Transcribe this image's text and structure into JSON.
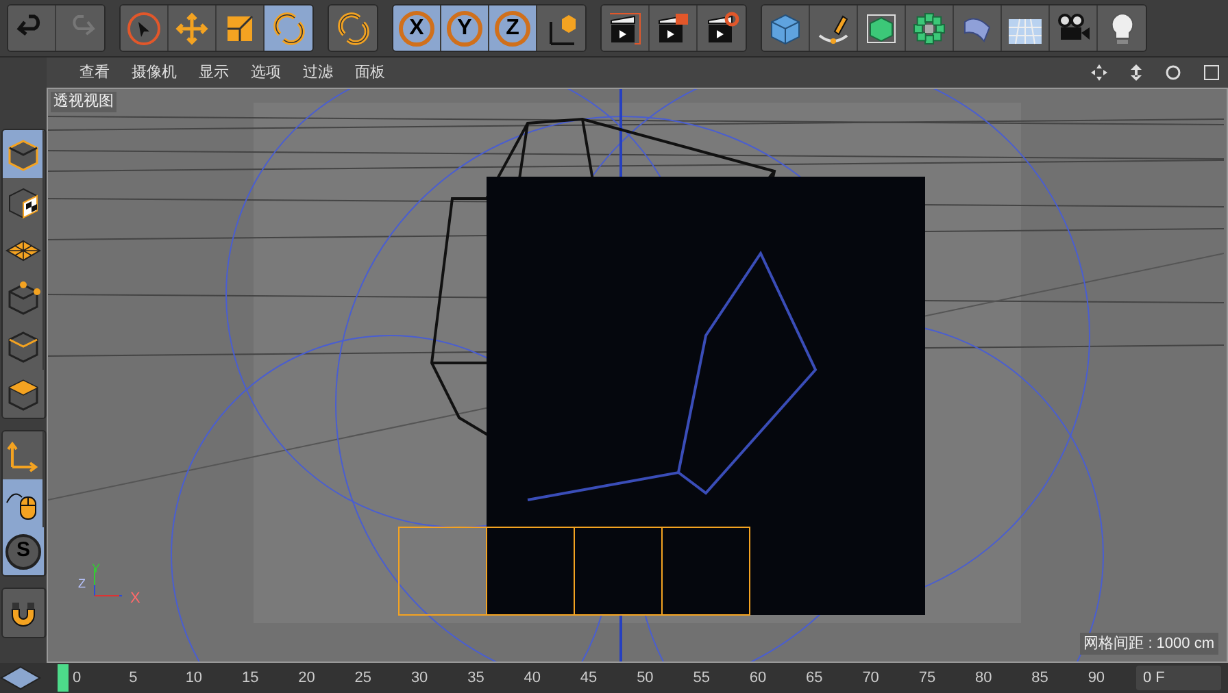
{
  "toolbar": {
    "groups": [
      {
        "buttons": [
          {
            "kind": "undo",
            "selected": false
          },
          {
            "kind": "redo",
            "selected": false
          }
        ]
      },
      {
        "buttons": [
          {
            "kind": "select",
            "selected": false
          },
          {
            "kind": "move",
            "selected": false
          },
          {
            "kind": "scale",
            "selected": false
          },
          {
            "kind": "rotate",
            "selected": true
          }
        ]
      },
      {
        "buttons": [
          {
            "kind": "rotate",
            "selected": false
          }
        ]
      },
      {
        "buttons": [
          {
            "kind": "axis",
            "label": "X",
            "selected": true
          },
          {
            "kind": "axis",
            "label": "Y",
            "selected": true
          },
          {
            "kind": "axis",
            "label": "Z",
            "selected": true
          },
          {
            "kind": "coords",
            "selected": false
          }
        ]
      },
      {
        "buttons": [
          {
            "kind": "render",
            "selected": false
          },
          {
            "kind": "render-view",
            "selected": false
          },
          {
            "kind": "render-settings",
            "selected": false
          }
        ]
      },
      {
        "buttons": [
          {
            "kind": "cube",
            "selected": false
          },
          {
            "kind": "pen",
            "selected": false
          },
          {
            "kind": "green-cube",
            "selected": false
          },
          {
            "kind": "cloner",
            "selected": false
          },
          {
            "kind": "bend",
            "selected": false
          },
          {
            "kind": "floor",
            "selected": false
          },
          {
            "kind": "camera",
            "selected": false
          },
          {
            "kind": "light",
            "selected": false
          }
        ]
      }
    ]
  },
  "sidebar": {
    "groups": [
      {
        "buttons": [
          {
            "kind": "model",
            "selected": true
          },
          {
            "kind": "texture",
            "selected": false
          },
          {
            "kind": "workplane",
            "selected": false
          },
          {
            "kind": "points",
            "selected": false
          },
          {
            "kind": "edges",
            "selected": false
          },
          {
            "kind": "polygons",
            "selected": false
          }
        ]
      },
      {
        "buttons": [
          {
            "kind": "axis",
            "selected": false
          },
          {
            "kind": "mouse",
            "selected": true
          },
          {
            "kind": "snap",
            "label": "S",
            "selected": true
          }
        ]
      },
      {
        "buttons": [
          {
            "kind": "magnet",
            "selected": false
          }
        ]
      }
    ]
  },
  "viewport": {
    "menu": [
      "查看",
      "摄像机",
      "显示",
      "选项",
      "过滤",
      "面板"
    ],
    "title": "透视视图",
    "axis_labels": [
      "Y",
      "Z",
      "X"
    ],
    "grid_spacing": "网格间距 : 1000 cm"
  },
  "timeline": {
    "ticks": [
      "0",
      "5",
      "10",
      "15",
      "20",
      "25",
      "30",
      "35",
      "40",
      "45",
      "50",
      "55",
      "60",
      "65",
      "70",
      "75",
      "80",
      "85",
      "90"
    ],
    "current_frame": "0 F"
  }
}
